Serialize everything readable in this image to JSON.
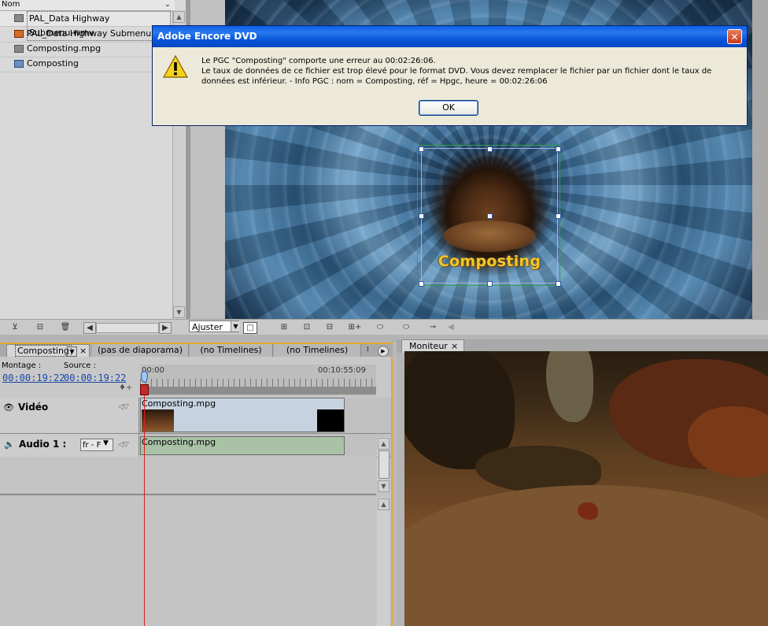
{
  "project": {
    "header": "Nom",
    "items": [
      {
        "label": "PAL_Data Highway Submenu.wmv",
        "icon": "video-file-icon"
      },
      {
        "label": "PAL_Data Highway Submenu",
        "icon": "menu-icon"
      },
      {
        "label": "Composting.mpg",
        "icon": "video-file-icon"
      },
      {
        "label": "Composting",
        "icon": "timeline-icon"
      }
    ]
  },
  "menu_button": {
    "label": "Composting"
  },
  "preview_toolbar": {
    "zoom": "Ajuster"
  },
  "timeline": {
    "tabs": [
      {
        "label": "Composting",
        "active": true
      },
      {
        "label": "(pas de diaporama)",
        "active": false
      },
      {
        "label": "(no Timelines)",
        "active": false
      },
      {
        "label": "(no Timelines)",
        "active": false
      }
    ],
    "montage_label": "Montage :",
    "montage_value": "00:00:19:22",
    "source_label": "Source :",
    "source_value": "00:00:19:22",
    "ruler_start": "00:00",
    "ruler_end": "00:10:55:09",
    "video_track": {
      "label": "Vidéo",
      "clip": "Composting.mpg"
    },
    "audio_track": {
      "label": "Audio 1 :",
      "language": "fr - F",
      "clip": "Composting.mpg"
    }
  },
  "monitor": {
    "tab": "Moniteur"
  },
  "dialog": {
    "title": "Adobe Encore DVD",
    "line1": "Le PGC \"Composting\" comporte une erreur au 00:02:26:06.",
    "line2": "Le taux de données de ce fichier est trop élevé pour le format DVD. Vous devez remplacer le fichier par un fichier dont le taux de données est inférieur. - Info PGC :  nom = Composting, réf = Hpgc, heure = 00:02:26:06",
    "ok": "OK"
  }
}
